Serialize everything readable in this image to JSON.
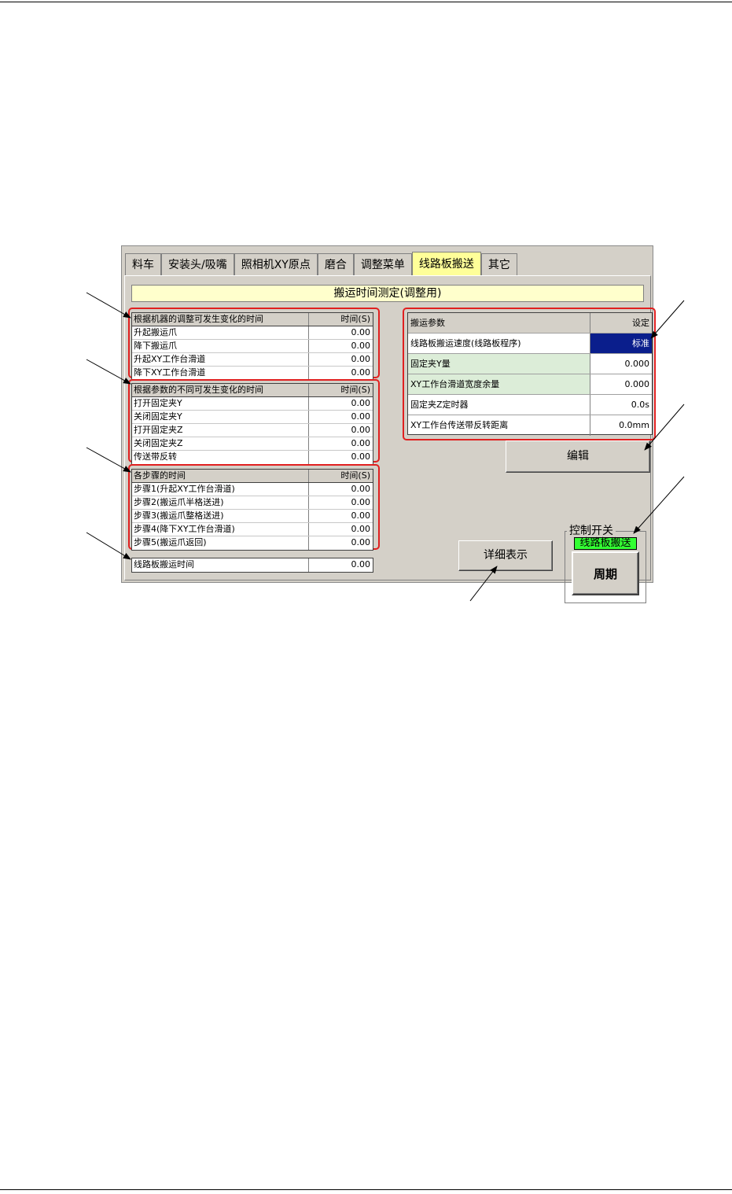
{
  "tabs": [
    {
      "label": "料车"
    },
    {
      "label": "安装头/吸嘴"
    },
    {
      "label": "照相机XY原点"
    },
    {
      "label": "磨合"
    },
    {
      "label": "调整菜单"
    },
    {
      "label": "线路板搬送"
    },
    {
      "label": "其它"
    }
  ],
  "active_tab": "线路板搬送",
  "section_title": "搬运时间测定(调整用)",
  "group1": {
    "header": "根据机器的调整可发生变化的时间",
    "col": "时间(S)",
    "rows": [
      {
        "label": "升起搬运爪",
        "value": "0.00"
      },
      {
        "label": "降下搬运爪",
        "value": "0.00"
      },
      {
        "label": "升起XY工作台滑道",
        "value": "0.00"
      },
      {
        "label": "降下XY工作台滑道",
        "value": "0.00"
      }
    ]
  },
  "group2": {
    "header": "根据参数的不同可发生变化的时间",
    "col": "时间(S)",
    "rows": [
      {
        "label": "打开固定夹Y",
        "value": "0.00"
      },
      {
        "label": "关闭固定夹Y",
        "value": "0.00"
      },
      {
        "label": "打开固定夹Z",
        "value": "0.00"
      },
      {
        "label": "关闭固定夹Z",
        "value": "0.00"
      },
      {
        "label": "传送带反转",
        "value": "0.00"
      }
    ]
  },
  "group3": {
    "header": "各步骤的时间",
    "col": "时间(S)",
    "rows": [
      {
        "label": "步骤1(升起XY工作台滑道)",
        "value": "0.00"
      },
      {
        "label": "步骤2(搬运爪半格送进)",
        "value": "0.00"
      },
      {
        "label": "步骤3(搬运爪整格送进)",
        "value": "0.00"
      },
      {
        "label": "步骤4(降下XY工作台滑道)",
        "value": "0.00"
      },
      {
        "label": "步骤5(搬运爪返回)",
        "value": "0.00"
      }
    ]
  },
  "total": {
    "label": "线路板搬运时间",
    "value": "0.00"
  },
  "params": {
    "header": "搬运参数",
    "col": "设定",
    "rows": [
      {
        "label": "线路板搬运速度(线路板程序)",
        "value": "标准"
      },
      {
        "label": "固定夹Y量",
        "value": "0.000"
      },
      {
        "label": "XY工作台滑道宽度余量",
        "value": "0.000"
      },
      {
        "label": "固定夹Z定时器",
        "value": "0.0s"
      },
      {
        "label": "XY工作台传送带反转距离",
        "value": "0.0mm"
      }
    ]
  },
  "buttons": {
    "edit": "编辑",
    "detail": "详细表示",
    "cycle": "周期"
  },
  "control": {
    "label": "控制开关",
    "status": "线路板搬送"
  }
}
